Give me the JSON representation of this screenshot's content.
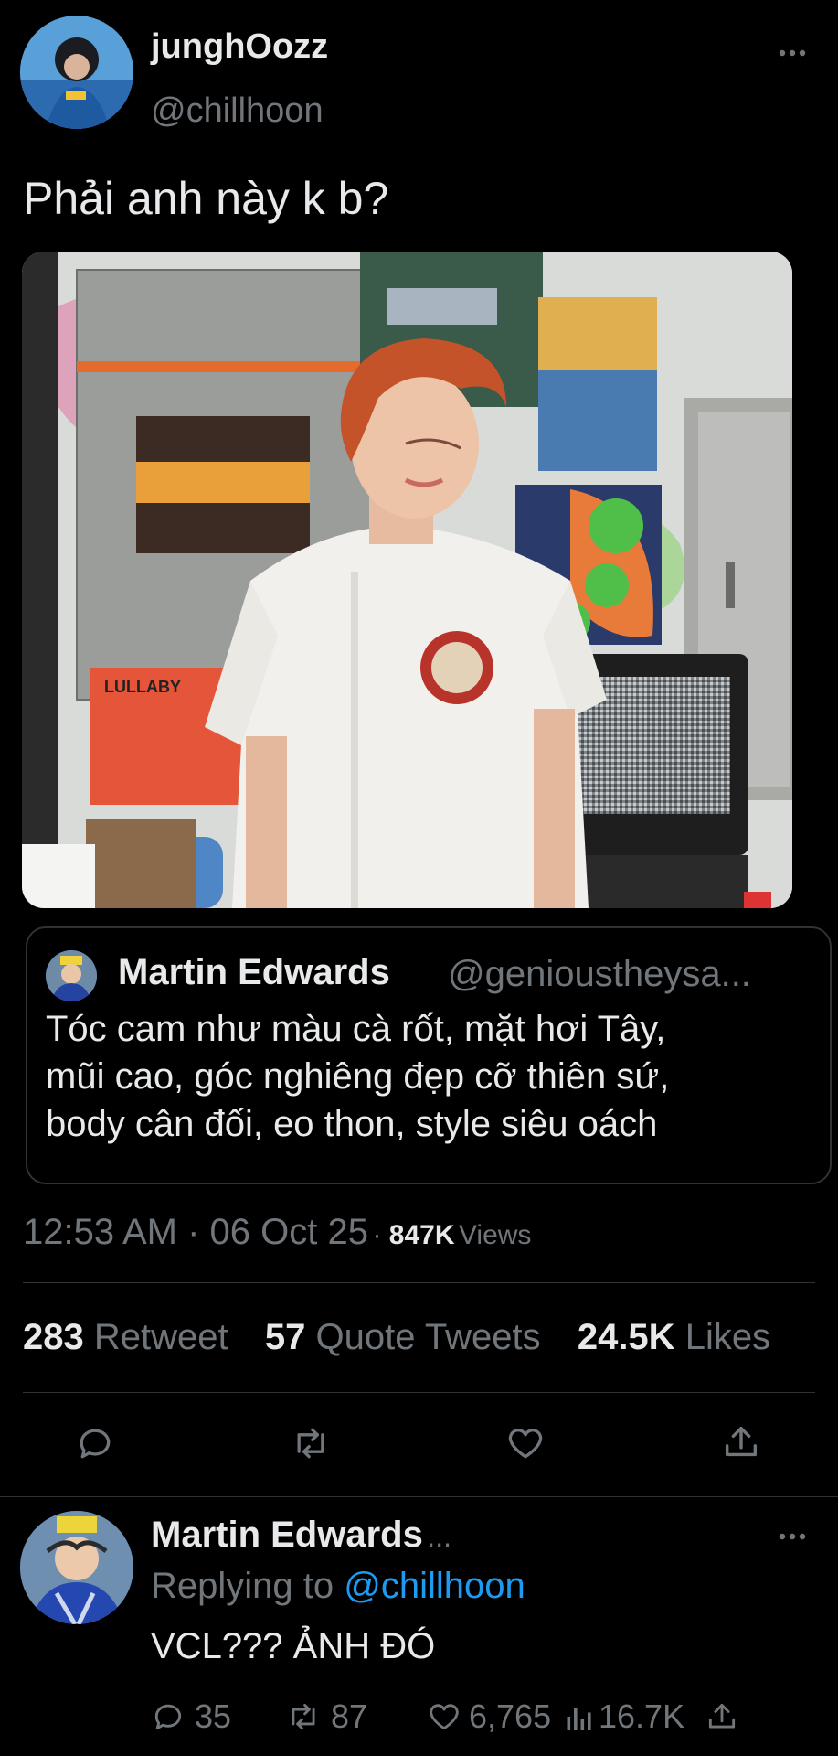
{
  "tweet": {
    "author_name": "junghOozz",
    "author_handle": "@chillhoon",
    "text": "Phải anh này k b?",
    "timestamp": "12:53 AM · 06 Oct 25",
    "views_count": "847K",
    "views_label": "Views",
    "stats": {
      "retweets": "283",
      "retweets_label": "Retweet",
      "quotes": "57",
      "quotes_label": "Quote Tweets",
      "likes": "24.5K",
      "likes_label": "Likes"
    }
  },
  "photo": {
    "poster_text": "LULLABY"
  },
  "quoted_tweet": {
    "author_name": "Martin Edwards",
    "author_handle": "@genioustheysa...",
    "text_line1": "Tóc cam như màu cà rốt, mặt hơi Tây,",
    "text_line2": "mũi cao, góc nghiêng đẹp cỡ thiên sứ,",
    "text_line3": "body cân đối, eo thon, style siêu oách"
  },
  "reply": {
    "author_name": "Martin Edwards",
    "author_suffix": "...",
    "replying_prefix": "Replying to",
    "replying_handle": "@chillhoon",
    "text": "VCL??? ẢNH ĐÓ",
    "reply_count": "35",
    "retweet_count": "87",
    "like_count": "6,765",
    "view_count": "16.7K"
  },
  "icons": {
    "more": "more-horizontal-icon",
    "reply": "comment-icon",
    "retweet": "retweet-icon",
    "like": "heart-icon",
    "share": "share-icon",
    "views": "bar-chart-icon"
  },
  "colors": {
    "background": "#000000",
    "text": "#e7e9ea",
    "muted": "#71767b",
    "accent": "#1d9bf0",
    "divider": "#2f3336"
  }
}
